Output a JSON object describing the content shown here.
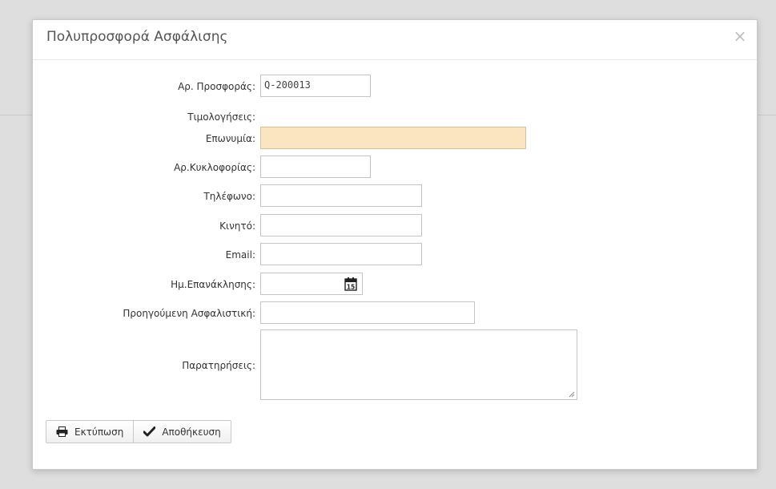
{
  "modal": {
    "title": "Πολυπροσφορά Ασφάλισης",
    "close_glyph": "×"
  },
  "form": {
    "offer_number": {
      "label": "Αρ. Προσφοράς:",
      "value": "Q-200013"
    },
    "invoicing": {
      "label": "Τιμολογήσεις:"
    },
    "company_name": {
      "label": "Επωνυμία:",
      "value": ""
    },
    "plate_number": {
      "label": "Αρ.Κυκλοφορίας:",
      "value": ""
    },
    "phone": {
      "label": "Τηλέφωνο:",
      "value": ""
    },
    "mobile": {
      "label": "Κινητό:",
      "value": ""
    },
    "email": {
      "label": "Email:",
      "value": ""
    },
    "recall_date": {
      "label": "Ημ.Επανάκλησης:",
      "value": "",
      "calendar_day": "15"
    },
    "previous_insurer": {
      "label": "Προηγούμενη Ασφαλιστική:",
      "value": ""
    },
    "notes": {
      "label": "Παρατηρήσεις:",
      "value": ""
    }
  },
  "actions": {
    "print_label": "Εκτύπωση",
    "save_label": "Αποθήκευση"
  },
  "colors": {
    "highlight_field": "#fbe5c1",
    "backdrop": "#dedede"
  },
  "icons": {
    "close": "close-icon",
    "calendar": "calendar-icon",
    "print": "printer-icon",
    "save": "checkmark-icon"
  }
}
